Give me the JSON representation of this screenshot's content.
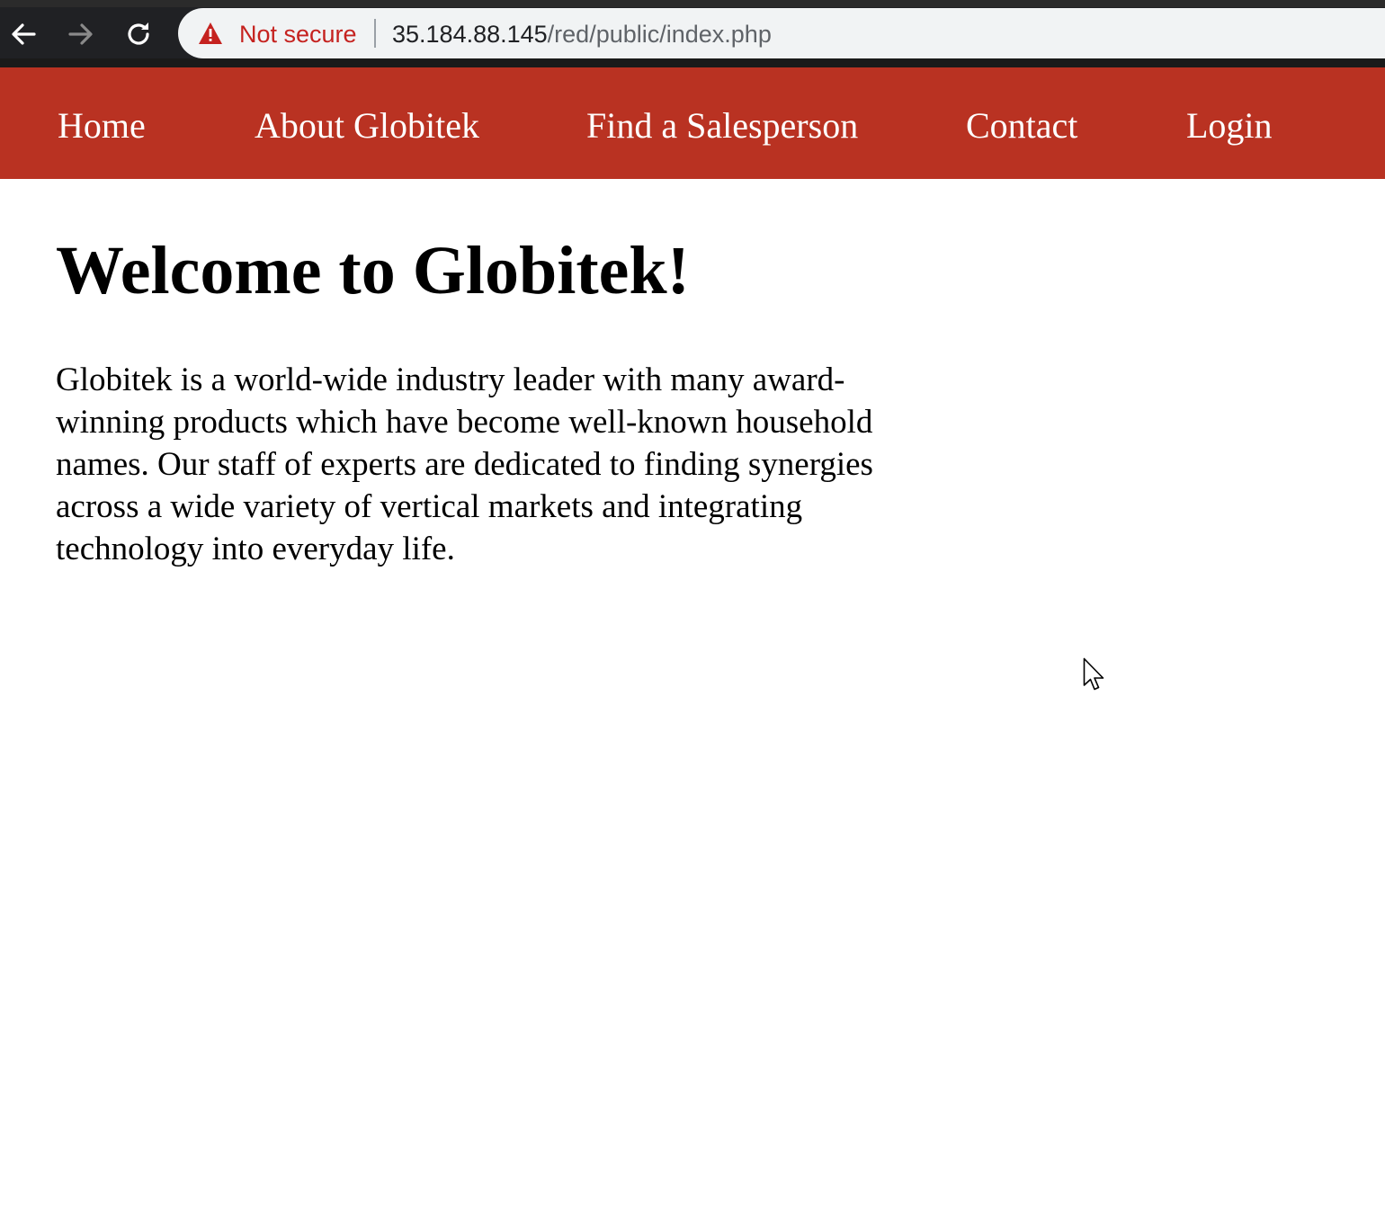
{
  "browser": {
    "security_label": "Not secure",
    "url_host": "35.184.88.145",
    "url_path": "/red/public/index.php"
  },
  "nav": {
    "items": [
      {
        "label": "Home"
      },
      {
        "label": "About Globitek"
      },
      {
        "label": "Find a Salesperson"
      },
      {
        "label": "Contact"
      },
      {
        "label": "Login"
      }
    ],
    "background_color": "#b93222",
    "text_color": "#ffffff"
  },
  "main": {
    "title": "Welcome to Globitek!",
    "intro": "Globitek is a world-wide industry leader with many award-winning products which have become well-known household names. Our staff of experts are dedicated to finding synergies across a wide variety of vertical markets and integrating technology into everyday life."
  },
  "icons": {
    "back": "arrow-left-icon",
    "forward": "arrow-right-icon",
    "reload": "reload-icon",
    "security": "warning-triangle-icon",
    "cursor": "mouse-pointer-icon"
  },
  "colors": {
    "warning_red": "#c5221f",
    "chrome_dark": "#202124",
    "omnibox_bg": "#f1f3f4"
  }
}
